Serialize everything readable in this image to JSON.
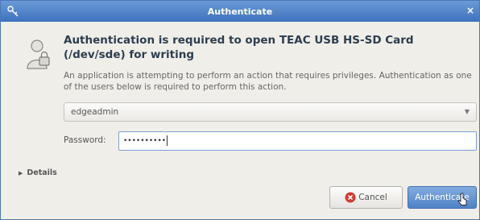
{
  "window": {
    "title": "Authenticate",
    "close_glyph": "×",
    "app_icon": "keys-icon"
  },
  "dialog": {
    "icon": "admin-lock-icon",
    "heading": "Authentication is required to open TEAC USB  HS-SD Card (/dev/sde) for writing",
    "description": "An application is attempting to perform an action that requires privileges. Authentication as one of the users below is required to perform this action."
  },
  "user_select": {
    "value": "edgeadmin",
    "caret": "▼"
  },
  "password": {
    "label": "Password:",
    "masked_value": "••••••••••"
  },
  "details": {
    "label": "Details",
    "arrow": "▶"
  },
  "buttons": {
    "cancel_label": "Cancel",
    "authenticate_label": "Authenticate"
  },
  "colors": {
    "titlebar": "#3d72bd",
    "dialog_bg": "#f0eee9",
    "primary_button": "#4f83c6",
    "cancel_icon": "#d43b30"
  }
}
